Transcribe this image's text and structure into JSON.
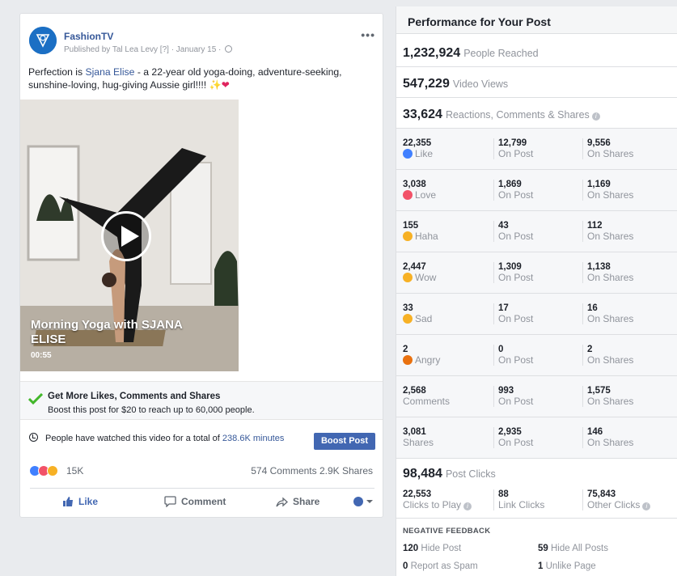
{
  "post": {
    "page_name": "FashionTV",
    "published_by": "Published by Tal Lea Levy",
    "published_meta": "[?] · January 15 ·",
    "more": "•••",
    "caption_before": "Perfection is ",
    "caption_link": "Sjana Elise",
    "caption_after": " - a 22-year old yoga-doing, adventure-seeking, sunshine-loving, hug-giving Aussie girl!!!! ",
    "video_title": "Morning Yoga with SJANA ELISE",
    "video_duration": "00:55",
    "promo_title": "Get More Likes, Comments and Shares",
    "promo_sub": "Boost this post for $20 to reach up to 60,000 people.",
    "watch_before": "People have watched this video for a total of ",
    "watch_link": "238.6K minutes",
    "boost_label": "Boost Post",
    "reaction_count": "15K",
    "comments_shares": "574 Comments  2.9K Shares",
    "like_label": "Like",
    "comment_label": "Comment",
    "share_label": "Share"
  },
  "panel": {
    "title": "Performance for Your Post",
    "reached_num": "1,232,924",
    "reached_lbl": "People Reached",
    "views_num": "547,229",
    "views_lbl": "Video Views",
    "engage_num": "33,624",
    "engage_lbl": "Reactions, Comments & Shares",
    "rows": [
      {
        "v1": "22,355",
        "l1": "Like",
        "v2": "12,799",
        "l2": "On Post",
        "v3": "9,556",
        "l3": "On Shares",
        "emoji_color": "#4080ff"
      },
      {
        "v1": "3,038",
        "l1": "Love",
        "v2": "1,869",
        "l2": "On Post",
        "v3": "1,169",
        "l3": "On Shares",
        "emoji_color": "#f25268"
      },
      {
        "v1": "155",
        "l1": "Haha",
        "v2": "43",
        "l2": "On Post",
        "v3": "112",
        "l3": "On Shares",
        "emoji_color": "#f7b125"
      },
      {
        "v1": "2,447",
        "l1": "Wow",
        "v2": "1,309",
        "l2": "On Post",
        "v3": "1,138",
        "l3": "On Shares",
        "emoji_color": "#f7b125"
      },
      {
        "v1": "33",
        "l1": "Sad",
        "v2": "17",
        "l2": "On Post",
        "v3": "16",
        "l3": "On Shares",
        "emoji_color": "#f7b125"
      },
      {
        "v1": "2",
        "l1": "Angry",
        "v2": "0",
        "l2": "On Post",
        "v3": "2",
        "l3": "On Shares",
        "emoji_color": "#e9710f"
      },
      {
        "v1": "2,568",
        "l1": "Comments",
        "v2": "993",
        "l2": "On Post",
        "v3": "1,575",
        "l3": "On Shares"
      },
      {
        "v1": "3,081",
        "l1": "Shares",
        "v2": "2,935",
        "l2": "On Post",
        "v3": "146",
        "l3": "On Shares"
      }
    ],
    "clicks_num": "98,484",
    "clicks_lbl": "Post Clicks",
    "play_v": "22,553",
    "play_l": "Clicks to Play",
    "link_v": "88",
    "link_l": "Link Clicks",
    "other_v": "75,843",
    "other_l": "Other Clicks",
    "neg_head": "NEGATIVE FEEDBACK",
    "hide_post_v": "120",
    "hide_post_l": "Hide Post",
    "hide_all_v": "59",
    "hide_all_l": "Hide All Posts",
    "spam_v": "0",
    "spam_l": "Report as Spam",
    "unlike_v": "1",
    "unlike_l": "Unlike Page"
  }
}
